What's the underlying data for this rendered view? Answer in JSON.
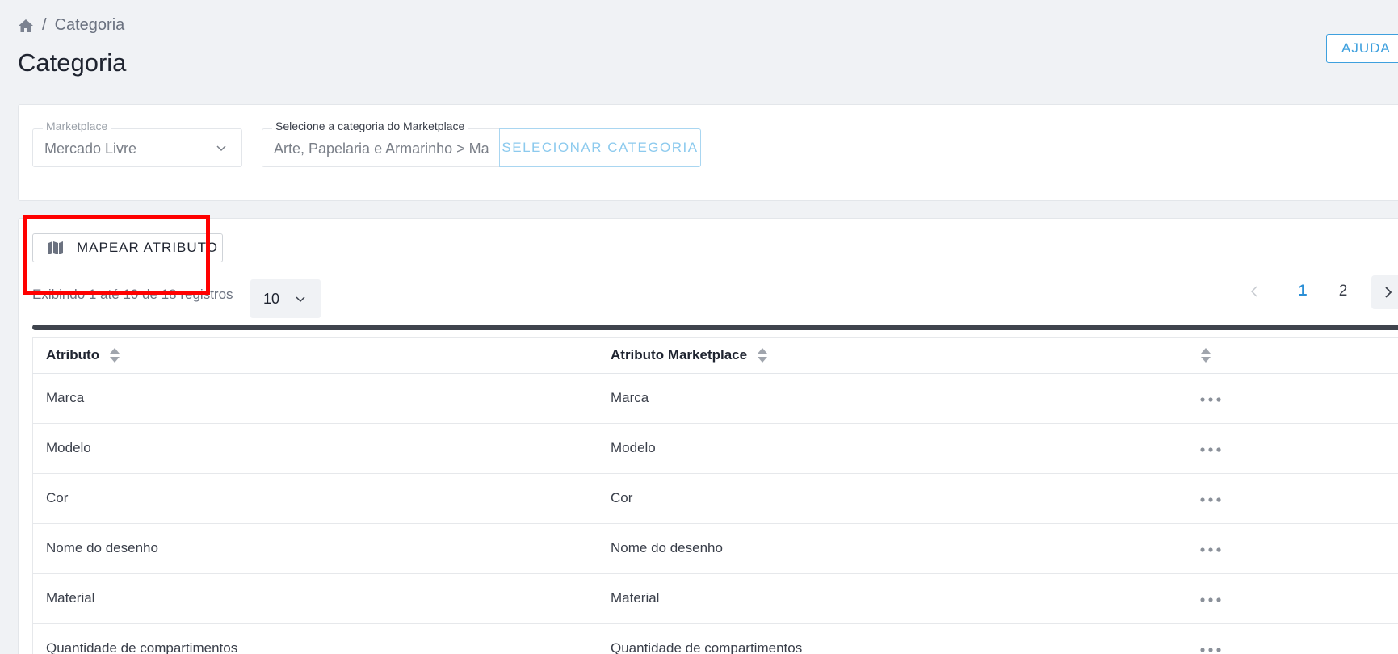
{
  "breadcrumb": {
    "home_icon": "home-icon",
    "separator": "/",
    "current": "Categoria"
  },
  "page": {
    "title": "Categoria",
    "help_label": "AJUDA"
  },
  "filters": {
    "marketplace": {
      "legend": "Marketplace",
      "value": "Mercado Livre"
    },
    "category": {
      "legend": "Selecione a categoria do Marketplace",
      "value": "Arte, Papelaria e Armarinho > Ma"
    },
    "select_button": "SELECIONAR CATEGORIA"
  },
  "toolbar": {
    "map_button": "MAPEAR ATRIBUTO",
    "map_icon": "map-icon"
  },
  "listing": {
    "records_info": "Exibindo 1 até 10 de 18 registros",
    "page_size": "10",
    "pages": [
      "1",
      "2"
    ],
    "current_page": "1"
  },
  "table": {
    "headers": [
      "Atributo",
      "Atributo Marketplace"
    ],
    "rows": [
      {
        "atributo": "Marca",
        "marketplace": "Marca"
      },
      {
        "atributo": "Modelo",
        "marketplace": "Modelo"
      },
      {
        "atributo": "Cor",
        "marketplace": "Cor"
      },
      {
        "atributo": "Nome do desenho",
        "marketplace": "Nome do desenho"
      },
      {
        "atributo": "Material",
        "marketplace": "Material"
      },
      {
        "atributo": "Quantidade de compartimentos",
        "marketplace": "Quantidade de compartimentos"
      }
    ]
  },
  "colors": {
    "accent": "#3ea0de",
    "highlight": "#ff0000"
  }
}
